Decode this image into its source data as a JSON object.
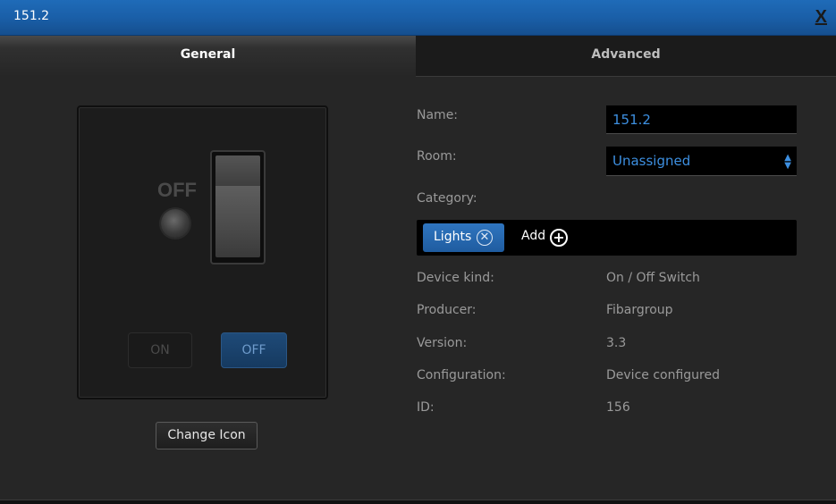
{
  "window": {
    "title": "151.2",
    "close_label": "X"
  },
  "tabs": [
    {
      "label": "General",
      "active": true
    },
    {
      "label": "Advanced",
      "active": false
    }
  ],
  "icon_panel": {
    "state_text": "OFF",
    "on_button": "ON",
    "off_button": "OFF",
    "change_icon_button": "Change Icon"
  },
  "form": {
    "name_label": "Name:",
    "name_value": "151.2",
    "room_label": "Room:",
    "room_value": "Unassigned",
    "category_label": "Category:",
    "category_chip": "Lights",
    "chip_remove_icon": "close-circle-icon",
    "add_label": "Add",
    "add_icon": "plus-circle-icon"
  },
  "details": {
    "device_kind_label": "Device kind:",
    "device_kind_value": "On / Off Switch",
    "producer_label": "Producer:",
    "producer_value": "Fibargroup",
    "version_label": "Version:",
    "version_value": "3.3",
    "configuration_label": "Configuration:",
    "configuration_value": "Device configured",
    "id_label": "ID:",
    "id_value": "156"
  },
  "colors": {
    "titlebar": "#1a5fa8",
    "accent_text": "#3d8fe0",
    "chip": "#2f75c0",
    "background": "#262626"
  }
}
